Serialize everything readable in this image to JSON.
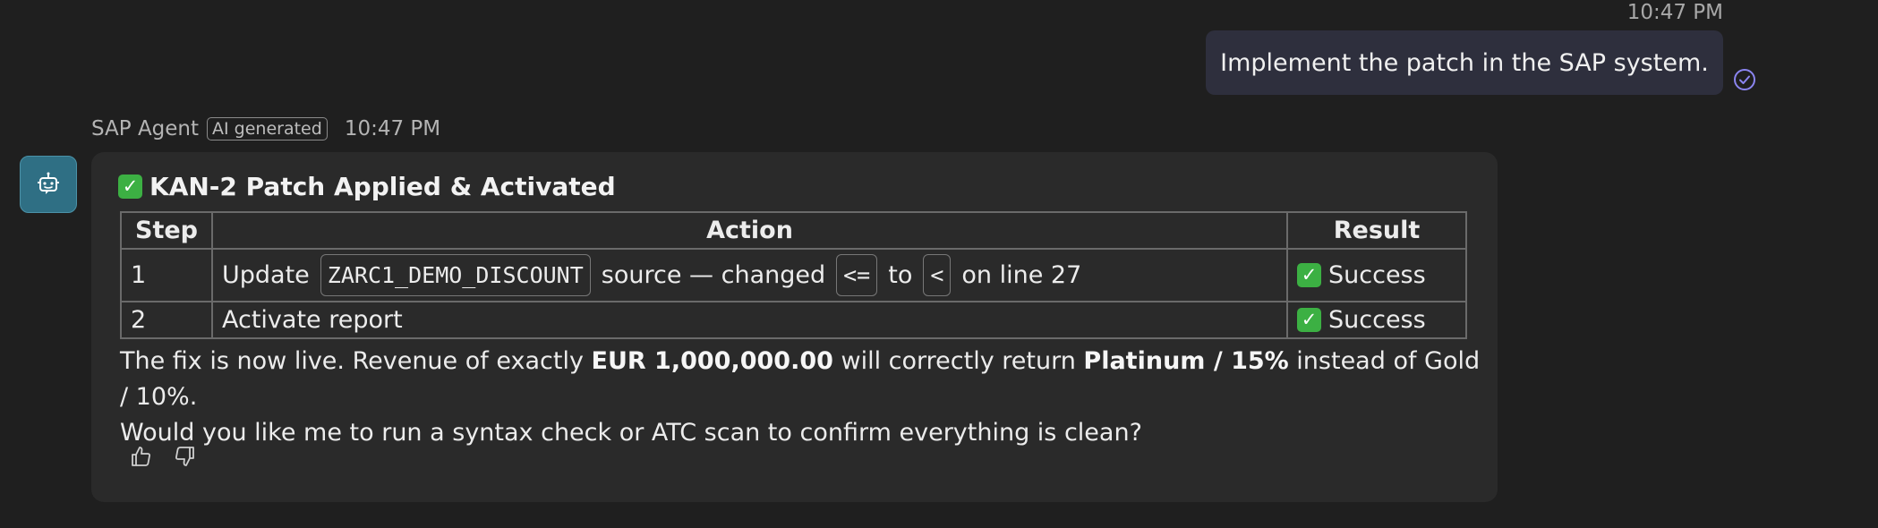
{
  "user_message": {
    "time": "10:47 PM",
    "text": "Implement the patch in the SAP system."
  },
  "agent": {
    "name": "SAP Agent",
    "badge": "AI generated",
    "time": "10:47 PM"
  },
  "card": {
    "title": "KAN-2 Patch Applied & Activated",
    "table": {
      "headers": [
        "Step",
        "Action",
        "Result"
      ],
      "rows": [
        {
          "step": "1",
          "action_parts": [
            "Update",
            "ZARC1_DEMO_DISCOUNT",
            "source — changed",
            "<=",
            "to",
            "<",
            "on line 27"
          ],
          "result": "Success"
        },
        {
          "step": "2",
          "action": "Activate report",
          "result": "Success"
        }
      ]
    },
    "summary": {
      "line1_a": "The fix is now live. Revenue of exactly ",
      "line1_b": "EUR 1,000,000.00",
      "line1_c": " will correctly return ",
      "line1_d": "Platinum / 15%",
      "line1_e": " instead of Gold / 10%.",
      "line2": "Would you like me to run a syntax check or ATC scan to confirm everything is clean?"
    },
    "feedback_icons": [
      "thumbs-up-icon",
      "thumbs-down-icon"
    ]
  },
  "colors": {
    "background": "#1f1f1f",
    "user_bubble": "#2e2f3d",
    "card": "#2a2a2a",
    "avatar": "#2f6f84",
    "success_check": "#3cb043",
    "read_check": "#8b85f0"
  }
}
